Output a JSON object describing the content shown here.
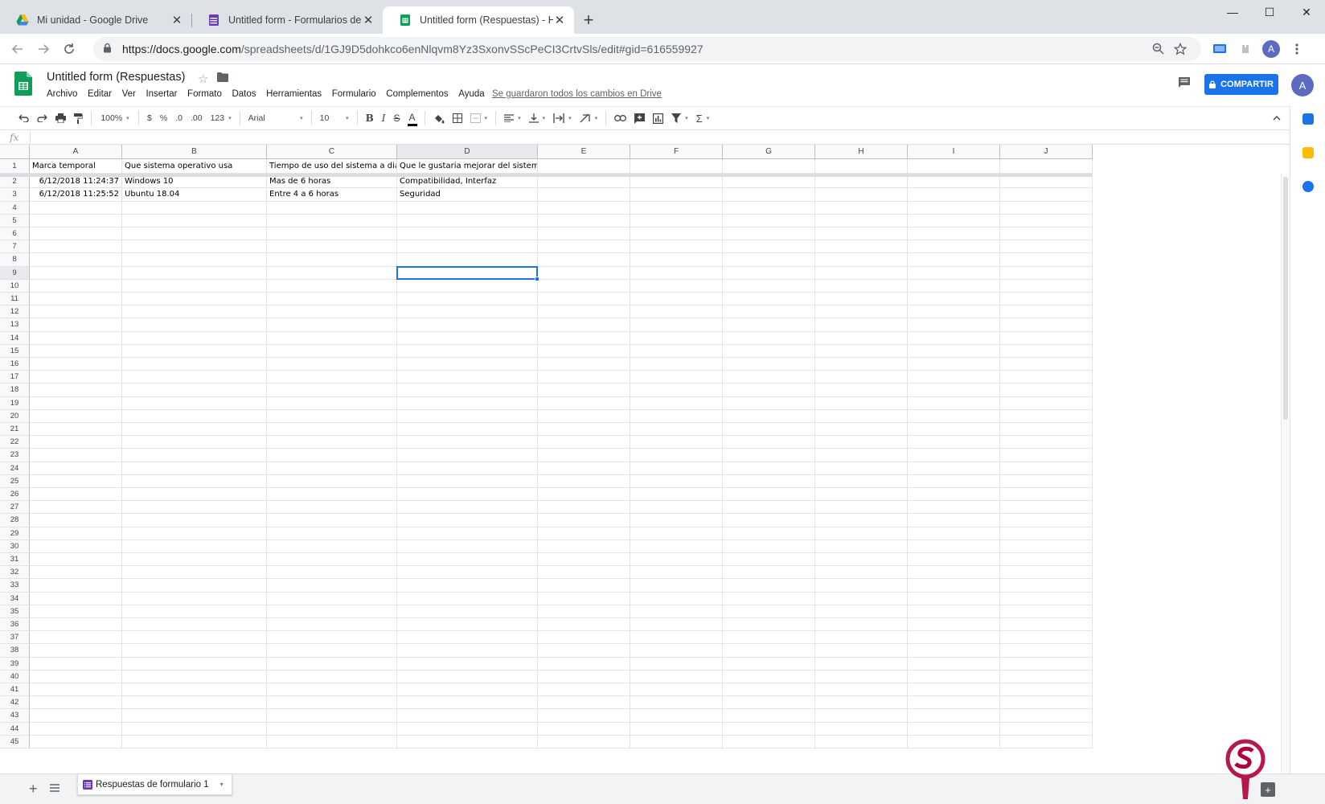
{
  "browser": {
    "tabs": [
      {
        "title": "Mi unidad - Google Drive",
        "icon": "google-drive-icon",
        "active": false
      },
      {
        "title": "Untitled form - Formularios de G",
        "icon": "google-forms-icon",
        "active": false
      },
      {
        "title": "Untitled form (Respuestas) - Hoja",
        "icon": "google-sheets-icon",
        "active": true
      }
    ],
    "url_host": "https://docs.google.com",
    "url_path": "/spreadsheets/d/1GJ9D5dohkco6enNlqvm8Yz3SxonvSScPeCI3CrtvSls/edit#gid=616559927",
    "profile_initial": "A"
  },
  "sheets": {
    "doc_title": "Untitled form (Respuestas)",
    "menu": [
      "Archivo",
      "Editar",
      "Ver",
      "Insertar",
      "Formato",
      "Datos",
      "Herramientas",
      "Formulario",
      "Complementos",
      "Ayuda"
    ],
    "save_status": "Se guardaron todos los cambios en Drive",
    "share_label": "COMPARTIR",
    "user_initial": "A"
  },
  "toolbar": {
    "zoom": "100%",
    "currency": "$",
    "percent": "%",
    "dec_decrease": ".0",
    "dec_increase": ".00",
    "more_formats": "123",
    "font": "Arial",
    "font_size": "10",
    "bold": "B",
    "italic": "I",
    "strike": "S",
    "text_color": "A",
    "sum": "Σ"
  },
  "formula_bar": {
    "label": "fx",
    "value": ""
  },
  "grid": {
    "columns": [
      "A",
      "B",
      "C",
      "D",
      "E",
      "F",
      "G",
      "H",
      "I",
      "J"
    ],
    "selected_column": "D",
    "selected_row": 9,
    "row_count": 45,
    "header_row": [
      "Marca temporal",
      "Que sistema operativo usa",
      "Tiempo de uso del sistema a diario",
      "Que le gustaria mejorar del sistema"
    ],
    "rows": [
      [
        "6/12/2018 11:24:37",
        "Windows 10",
        "Mas de 6 horas",
        "Compatibilidad, Interfaz"
      ],
      [
        "6/12/2018 11:25:52",
        "Ubuntu 18.04",
        "Entre 4 a 6 horas",
        "Seguridad"
      ]
    ]
  },
  "sheet_tabs": [
    {
      "name": "Respuestas de formulario 1"
    }
  ],
  "colors": {
    "accent": "#1a73e8",
    "sheets_green": "#0f9d58",
    "forms_purple": "#673ab7"
  }
}
